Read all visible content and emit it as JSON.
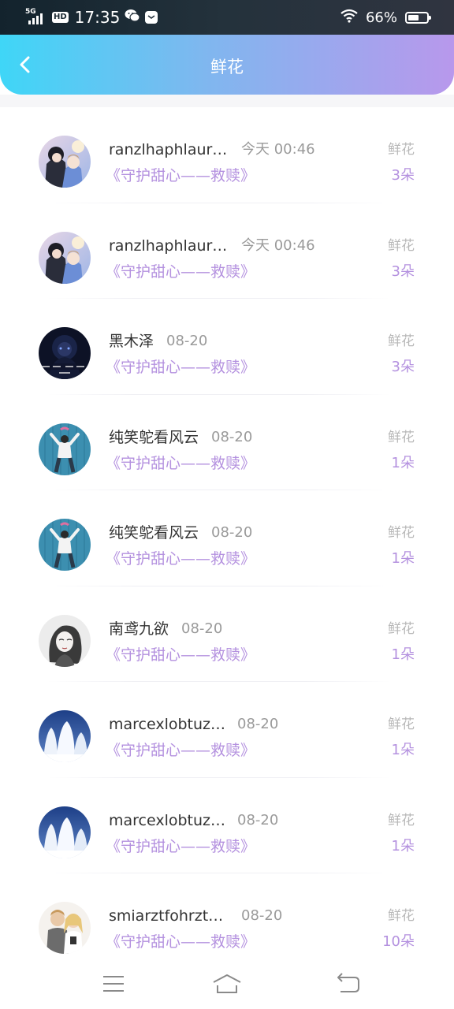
{
  "status_bar": {
    "network": "5G",
    "hd": "HD",
    "time": "17:35",
    "battery_percent": "66%",
    "battery_level": 0.66
  },
  "header": {
    "title": "鲜花",
    "back_icon": "chevron-left-icon"
  },
  "records": [
    {
      "name": "ranzlhaphlaur…",
      "time": "今天 00:46",
      "work": "《守护甜心——救赎》",
      "gift_label": "鲜花",
      "count": "3朵",
      "avatar": "anime-couple"
    },
    {
      "name": "ranzlhaphlaur…",
      "time": "今天 00:46",
      "work": "《守护甜心——救赎》",
      "gift_label": "鲜花",
      "count": "3朵",
      "avatar": "anime-couple"
    },
    {
      "name": "黑木泽",
      "time": "08-20",
      "work": "《守护甜心——救赎》",
      "gift_label": "鲜花",
      "count": "3朵",
      "avatar": "dark-anime"
    },
    {
      "name": "纯笑鸵看风云",
      "time": "08-20",
      "work": "《守护甜心——救赎》",
      "gift_label": "鲜花",
      "count": "1朵",
      "avatar": "blue-wall-figure"
    },
    {
      "name": "纯笑鸵看风云",
      "time": "08-20",
      "work": "《守护甜心——救赎》",
      "gift_label": "鲜花",
      "count": "1朵",
      "avatar": "blue-wall-figure"
    },
    {
      "name": "南鸢九欲",
      "time": "08-20",
      "work": "《守护甜心——救赎》",
      "gift_label": "鲜花",
      "count": "1朵",
      "avatar": "sketch-girl"
    },
    {
      "name": "marcexlobtuz…",
      "time": "08-20",
      "work": "《守护甜心——救赎》",
      "gift_label": "鲜花",
      "count": "1朵",
      "avatar": "snowy-trees"
    },
    {
      "name": "marcexlobtuz…",
      "time": "08-20",
      "work": "《守护甜心——救赎》",
      "gift_label": "鲜花",
      "count": "1朵",
      "avatar": "snowy-trees"
    },
    {
      "name": "smiarztfohrzt…",
      "time": "08-20",
      "work": "《守护甜心——救赎》",
      "gift_label": "鲜花",
      "count": "10朵",
      "avatar": "two-people"
    }
  ],
  "bottom_nav": {
    "menu_icon": "menu-icon",
    "home_icon": "home-icon",
    "back_icon": "back-icon"
  },
  "colors": {
    "accent": "#b491df",
    "header_start": "#3fd6f7",
    "header_end": "#b898ec"
  }
}
